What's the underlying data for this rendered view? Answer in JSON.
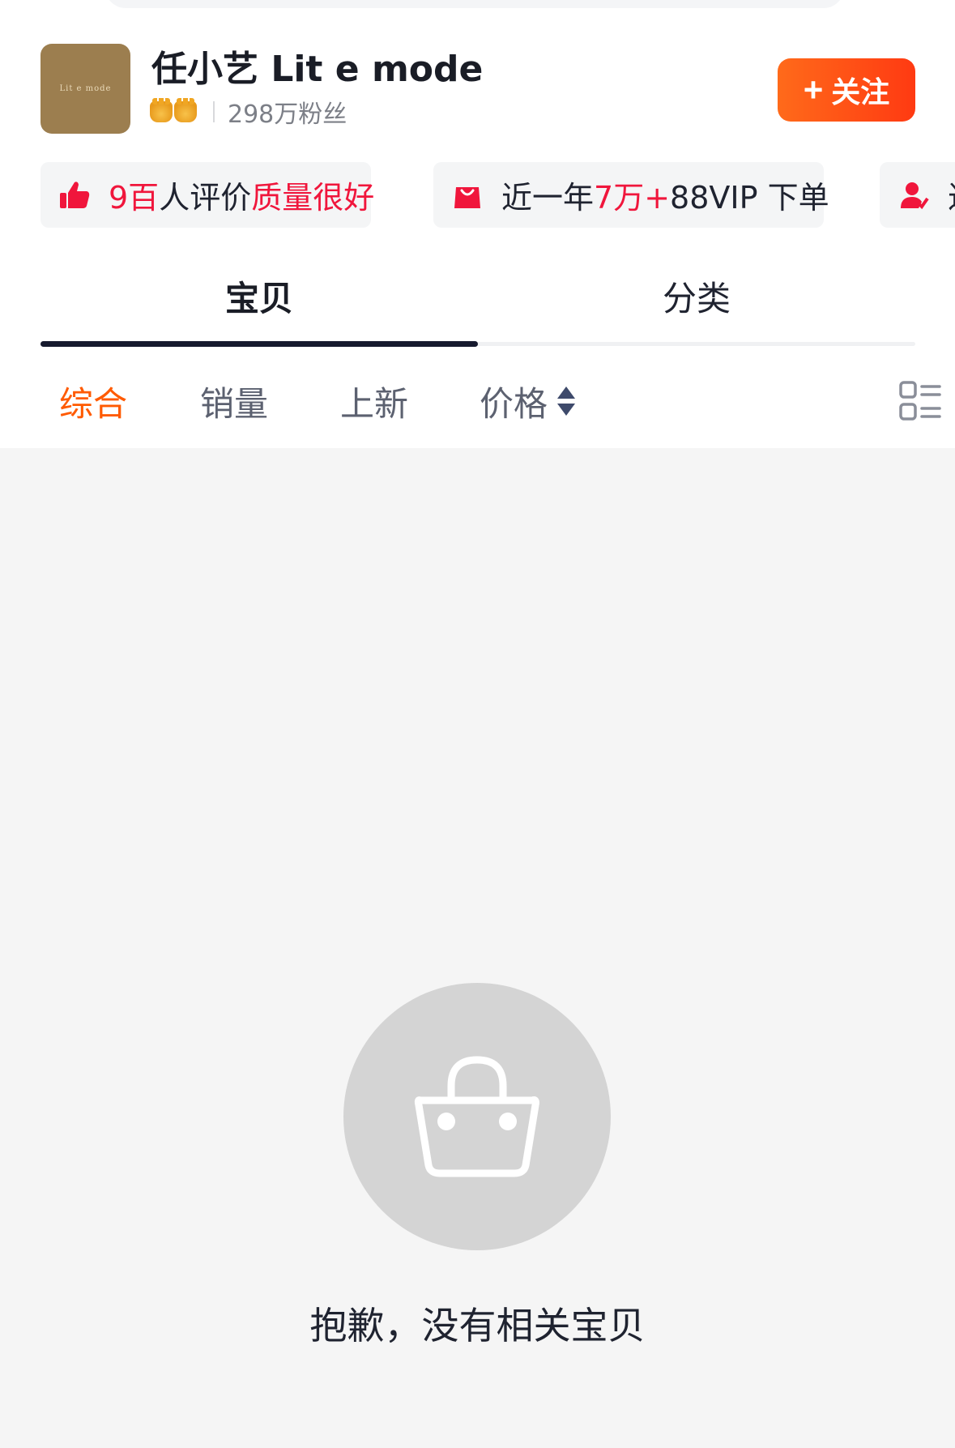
{
  "shop": {
    "name": "任小艺 Lit e mode",
    "logo_text": "Lit e mode",
    "fans": "298万粉丝",
    "follow_label": "关注",
    "follow_plus": "+"
  },
  "tags": [
    {
      "icon": "thumbs-up-icon",
      "count": "9百",
      "text": "人评价",
      "highlight": "质量很好"
    },
    {
      "icon": "shopping-bag-icon",
      "prefix": "近一年",
      "count": "7万+",
      "text": "88VIP 下单"
    },
    {
      "icon": "user-icon",
      "text": "近"
    }
  ],
  "tabs": [
    {
      "label": "宝贝",
      "active": true
    },
    {
      "label": "分类",
      "active": false
    }
  ],
  "sort": {
    "options": [
      "综合",
      "销量",
      "上新",
      "价格"
    ],
    "active": "综合"
  },
  "empty": {
    "message": "抱歉，没有相关宝贝",
    "icon": "shopping-basket-icon"
  },
  "colors": {
    "accent": "#ff5a00",
    "follow_gradient_start": "#ff6a1a",
    "follow_gradient_end": "#ff3a12",
    "highlight_red": "#f0163c",
    "tab_indicator": "#161a2e"
  }
}
